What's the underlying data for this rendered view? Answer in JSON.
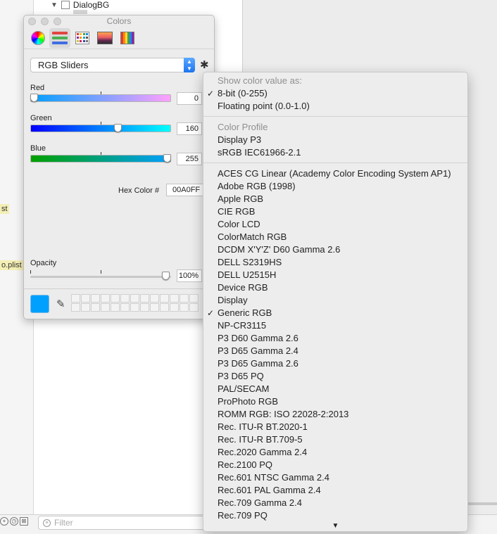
{
  "background": {
    "tree_item": "DialogBG",
    "plist_tags": [
      "st",
      "o.plist"
    ],
    "filter_placeholder": "Filter"
  },
  "colors_panel": {
    "title": "Colors",
    "toolbar_icons": [
      "color-wheel-icon",
      "color-sliders-icon",
      "color-palettes-icon",
      "image-palettes-icon",
      "pencils-icon"
    ],
    "mode": "RGB Sliders",
    "sliders": [
      {
        "label": "Red",
        "value": "0",
        "level": 0.0
      },
      {
        "label": "Green",
        "value": "160",
        "level": 0.627
      },
      {
        "label": "Blue",
        "value": "255",
        "level": 1.0
      }
    ],
    "hex_label": "Hex Color #",
    "hex_value": "00A0FF",
    "opacity_label": "Opacity",
    "opacity_value": "100%",
    "opacity_level": 1.0,
    "current_color": "#00A0FF"
  },
  "menu": {
    "show_value_header": "Show color value as:",
    "value_options": [
      {
        "label": "8-bit (0-255)",
        "checked": true
      },
      {
        "label": "Floating point (0.0-1.0)",
        "checked": false
      }
    ],
    "profile_header": "Color Profile",
    "profile_top": [
      {
        "label": "Display P3",
        "checked": false
      },
      {
        "label": "sRGB IEC61966-2.1",
        "checked": false
      }
    ],
    "profiles": [
      {
        "label": "ACES CG Linear (Academy Color Encoding System AP1)",
        "checked": false
      },
      {
        "label": "Adobe RGB (1998)",
        "checked": false
      },
      {
        "label": "Apple RGB",
        "checked": false
      },
      {
        "label": "CIE RGB",
        "checked": false
      },
      {
        "label": "Color LCD",
        "checked": false
      },
      {
        "label": "ColorMatch RGB",
        "checked": false
      },
      {
        "label": "DCDM X'Y'Z' D60 Gamma 2.6",
        "checked": false
      },
      {
        "label": "DELL S2319HS",
        "checked": false
      },
      {
        "label": "DELL U2515H",
        "checked": false
      },
      {
        "label": "Device RGB",
        "checked": false
      },
      {
        "label": "Display",
        "checked": false
      },
      {
        "label": "Generic RGB",
        "checked": true
      },
      {
        "label": "NP-CR3115",
        "checked": false
      },
      {
        "label": "P3 D60 Gamma 2.6",
        "checked": false
      },
      {
        "label": "P3 D65 Gamma 2.4",
        "checked": false
      },
      {
        "label": "P3 D65 Gamma 2.6",
        "checked": false
      },
      {
        "label": "P3 D65 PQ",
        "checked": false
      },
      {
        "label": "PAL/SECAM",
        "checked": false
      },
      {
        "label": "ProPhoto RGB",
        "checked": false
      },
      {
        "label": "ROMM RGB: ISO 22028-2:2013",
        "checked": false
      },
      {
        "label": "Rec. ITU-R BT.2020-1",
        "checked": false
      },
      {
        "label": "Rec. ITU-R BT.709-5",
        "checked": false
      },
      {
        "label": "Rec.2020 Gamma 2.4",
        "checked": false
      },
      {
        "label": "Rec.2100 PQ",
        "checked": false
      },
      {
        "label": "Rec.601 NTSC Gamma 2.4",
        "checked": false
      },
      {
        "label": "Rec.601 PAL Gamma 2.4",
        "checked": false
      },
      {
        "label": "Rec.709 Gamma 2.4",
        "checked": false
      },
      {
        "label": "Rec.709 PQ",
        "checked": false
      }
    ],
    "check_glyph": "✓",
    "scroll_glyph": "▼"
  }
}
